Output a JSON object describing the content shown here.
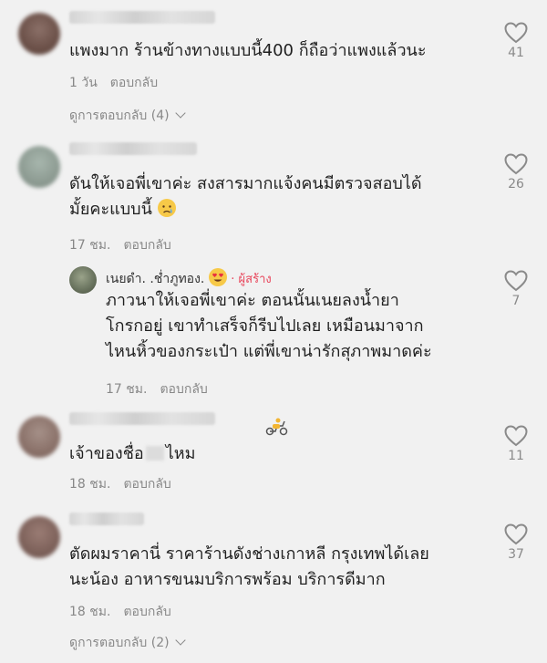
{
  "comments": [
    {
      "text": "แพงมาก ร้านข้างทางแบบนี้400 ก็ถือว่าแพงแล้วนะ",
      "time": "1 วัน",
      "reply_label": "ตอบกลับ",
      "likes": "41",
      "view_replies": "ดูการตอบกลับ (4)"
    },
    {
      "text_line1": "ดันให้เจอพี่เขาค่ะ สงสารมากแจ้งคนมีตรวจสอบได้",
      "text_line2": "มั้ยคะแบบนี้",
      "time": "17 ชม.",
      "reply_label": "ตอบกลับ",
      "likes": "26"
    },
    {
      "text": "เจ้าของชื่อ",
      "text_suffix": "ไหม",
      "time": "18 ชม.",
      "reply_label": "ตอบกลับ",
      "likes": "11"
    },
    {
      "text_line1": "ตัดผมราคานี่ ราคาร้านดังช่างเกาหลี กรุงเทพได้เลย",
      "text_line2": "นะน้อง อาหารขนมบริการพร้อม บริการดีมาก",
      "time": "18 ชม.",
      "reply_label": "ตอบกลับ",
      "likes": "37",
      "view_replies": "ดูการตอบกลับ (2)"
    }
  ],
  "creator_reply": {
    "name": "เนยดำ. .ช่ำภูทอง.",
    "badge": "· ผู้สร้าง",
    "line1": "ภาวนาให้เจอพี่เขาค่ะ ตอนนั้นเนยลงน้ำยา",
    "line2": "โกรกอยู่ เขาทำเสร็จก็รีบไปเลย เหมือนมาจาก",
    "line3": "ไหนหิ้วของกระเป๋า แต่พี่เขาน่ารักสุภาพมาดค่ะ",
    "time": "17 ชม.",
    "reply_label": "ตอบกลับ",
    "likes": "7"
  },
  "icons": {
    "like": "heart-outline-icon",
    "expand": "chevron-down-icon",
    "emoji_heart_eyes": "heart-eyes-emoji-icon",
    "emoji_crying": "crying-face-emoji-icon",
    "sticker": "scooter-sticker-icon"
  },
  "colors": {
    "background": "#f1f1f1",
    "text": "#1f1f1f",
    "muted": "#888888",
    "creator_badge": "#e8445a"
  }
}
